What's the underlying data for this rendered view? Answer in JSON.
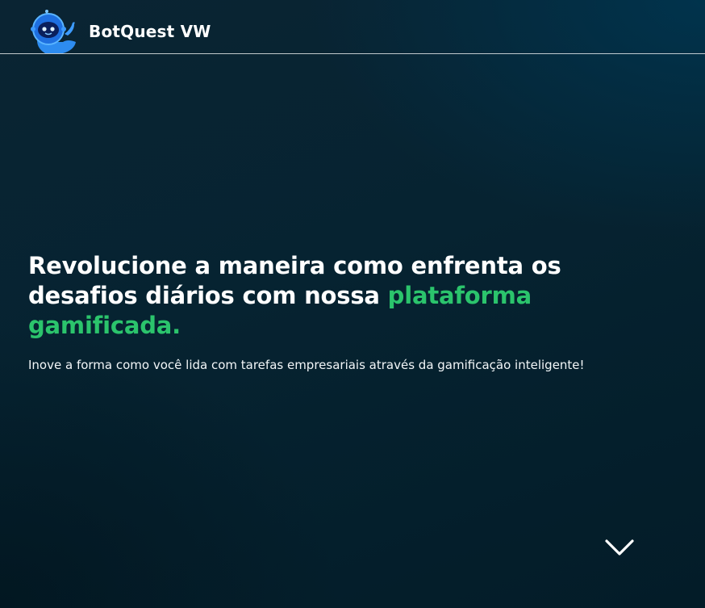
{
  "header": {
    "brand": "BotQuest VW",
    "logo_icon": "robot-mascot-icon"
  },
  "hero": {
    "headline_main": "Revolucione a maneira como enfrenta os desafios diários com nossa ",
    "headline_accent": "plataforma gamificada.",
    "subheadline": "Inove a forma como você lida com tarefas empresariais através da gamificação inteligente!"
  },
  "scroll": {
    "icon": "chevron-down-icon"
  },
  "colors": {
    "background": "#062331",
    "accent": "#2bc46c",
    "text": "#ffffff",
    "logo_blue": "#1e6fe0"
  }
}
